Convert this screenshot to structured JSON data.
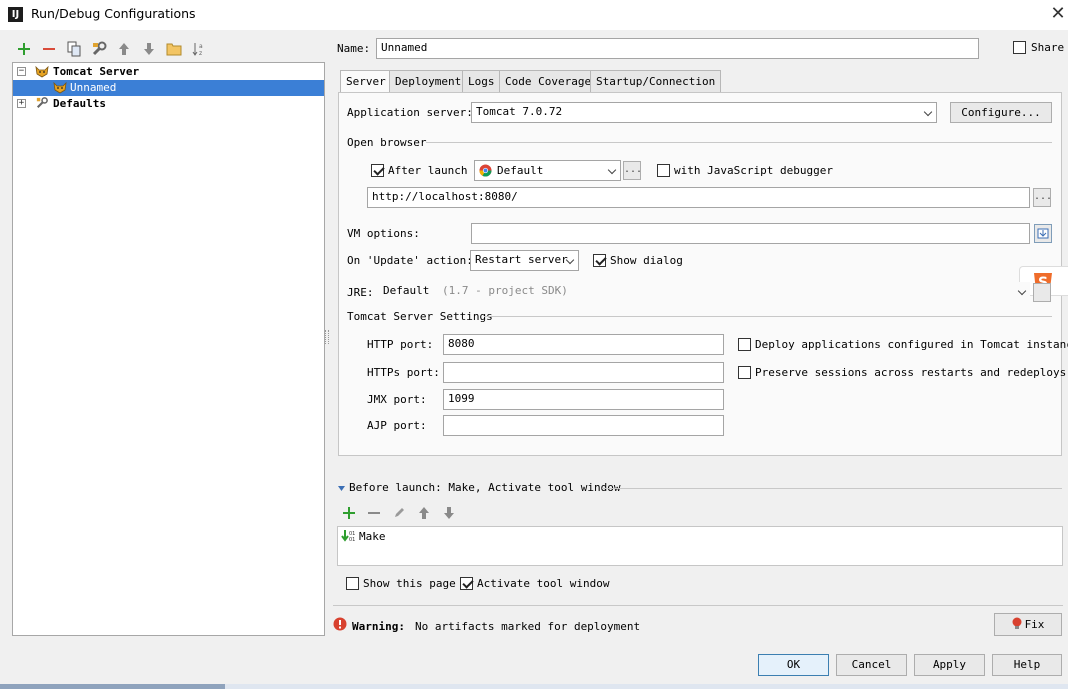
{
  "window": {
    "title": "Run/Debug Configurations",
    "logo_text": "IJ"
  },
  "icons": {
    "add": "plus-icon",
    "remove": "minus-icon",
    "copy": "copy-icon",
    "edit_defaults": "wrench-icon",
    "move_up": "arrow-up-icon",
    "move_down": "arrow-down-icon",
    "folder": "folder-icon",
    "sort": "sort-az-icon",
    "tomcat": "tomcat-icon",
    "defaults": "wrench-icon",
    "warning": "warning-icon",
    "browser": "chrome-icon",
    "make": "make-icon"
  },
  "tree": {
    "items": [
      {
        "label": "Tomcat Server",
        "expanded": true,
        "toggle": "−"
      },
      {
        "label": "Unnamed",
        "selected": true
      },
      {
        "label": "Defaults",
        "expanded": false,
        "toggle": "+"
      }
    ]
  },
  "name_row": {
    "label": "Name:",
    "value": "Unnamed",
    "share_label": "Share",
    "share_checked": false
  },
  "tabs": [
    {
      "label": "Server",
      "active": true
    },
    {
      "label": "Deployment"
    },
    {
      "label": "Logs"
    },
    {
      "label": "Code Coverage"
    },
    {
      "label": "Startup/Connection"
    }
  ],
  "server": {
    "app_server_label": "Application server:",
    "app_server_value": "Tomcat 7.0.72",
    "configure_label": "Configure...",
    "open_browser_label": "Open browser",
    "after_launch_label": "After launch",
    "after_launch_checked": true,
    "browser_value": "Default",
    "js_debugger_label": "with JavaScript debugger",
    "js_debugger_checked": false,
    "url_value": "http://localhost:8080/",
    "ellipsis": "...",
    "vm_options_label": "VM options:",
    "vm_options_value": "",
    "on_update_label": "On 'Update' action:",
    "on_update_value": "Restart server",
    "show_dialog_label": "Show dialog",
    "show_dialog_checked": true,
    "jre_label": "JRE:",
    "jre_value": "Default",
    "jre_hint": "(1.7 - project SDK)",
    "tomcat_settings_label": "Tomcat Server Settings",
    "http_port_label": "HTTP port:",
    "http_port_value": "8080",
    "https_port_label": "HTTPs port:",
    "https_port_value": "",
    "jmx_port_label": "JMX port:",
    "jmx_port_value": "1099",
    "ajp_port_label": "AJP port:",
    "ajp_port_value": "",
    "deploy_label": "Deploy applications configured in Tomcat instance",
    "deploy_checked": false,
    "preserve_label": "Preserve sessions across restarts and redeploys",
    "preserve_checked": false
  },
  "before_launch": {
    "title": "Before launch: Make, Activate tool window",
    "items": [
      {
        "label": "Make"
      }
    ],
    "show_page_label": "Show this page",
    "show_page_checked": false,
    "activate_label": "Activate tool window",
    "activate_checked": true
  },
  "warning": {
    "title": "Warning:",
    "message": "No artifacts marked for deployment",
    "fix_label": "Fix"
  },
  "footer": {
    "ok": "OK",
    "cancel": "Cancel",
    "apply": "Apply",
    "help": "Help"
  },
  "colors": {
    "selection": "#3b7fd6",
    "add_green": "#2f9e2f",
    "remove_red": "#d94b3a",
    "warning_red": "#d8412f"
  }
}
